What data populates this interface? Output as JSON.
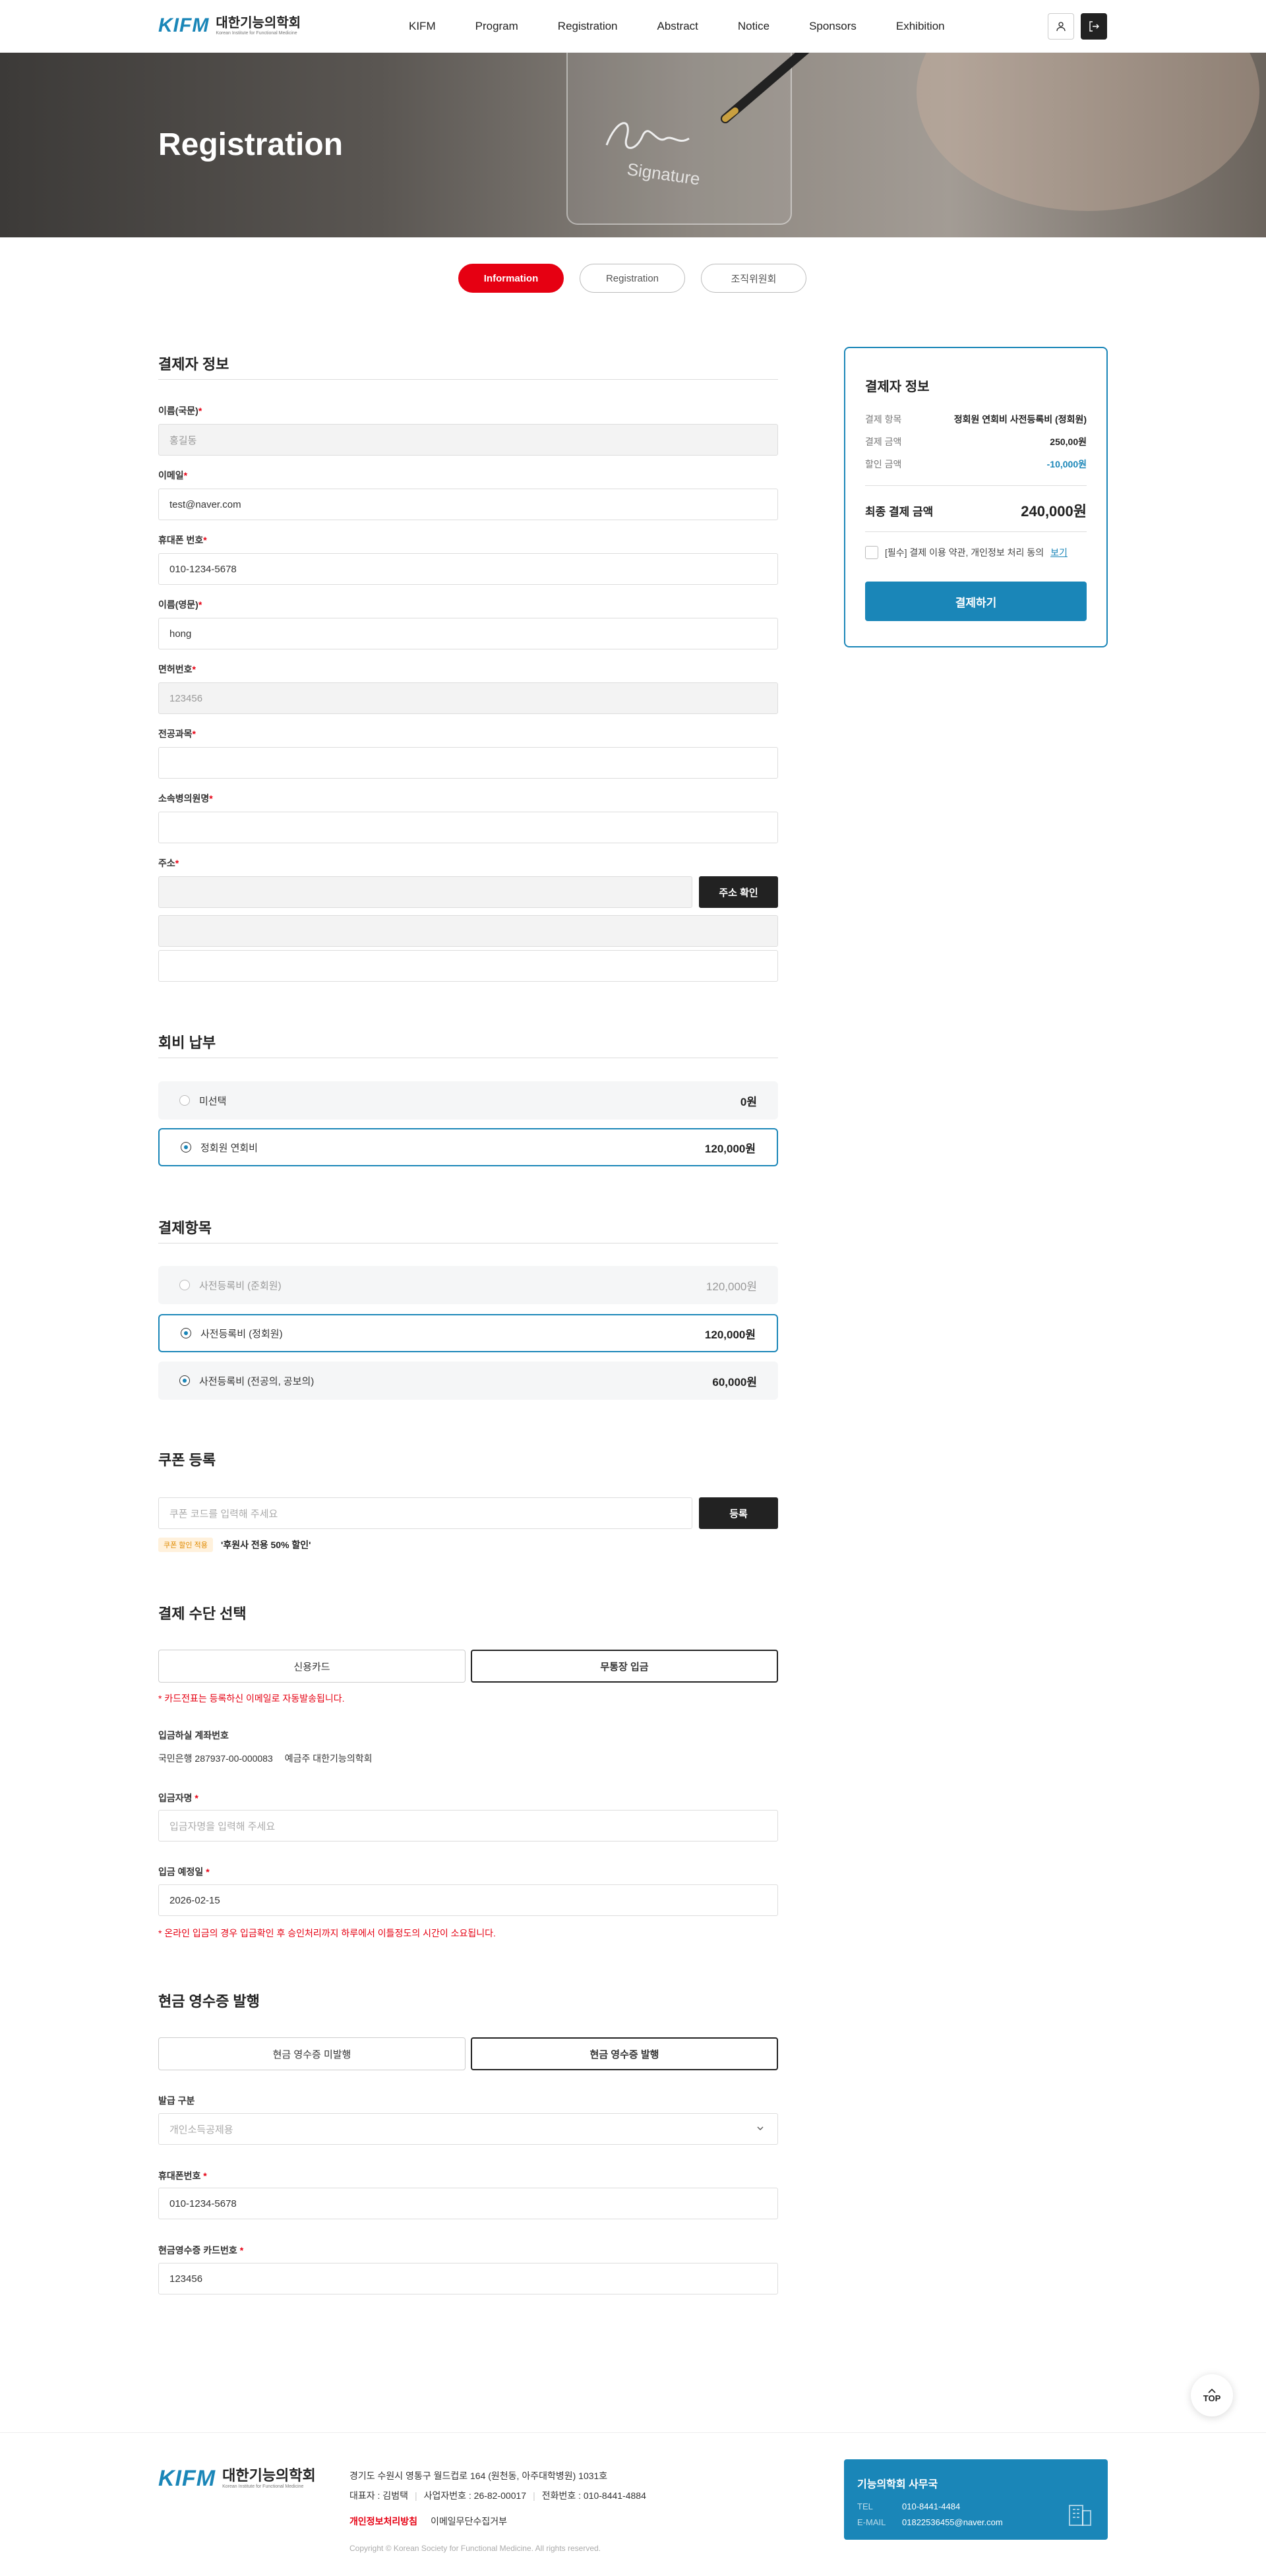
{
  "header": {
    "logo_mark": "KIFM",
    "logo_ko": "대한기능의학회",
    "logo_en": "Korean Institute for Functional Medicine",
    "nav": [
      "KIFM",
      "Program",
      "Registration",
      "Abstract",
      "Notice",
      "Sponsors",
      "Exhibition"
    ],
    "icons": {
      "user": "user-icon",
      "logout": "logout-icon"
    }
  },
  "hero": {
    "title": "Registration",
    "signature_text": "Signature"
  },
  "tabs": [
    "Information",
    "Registration",
    "조직위원회"
  ],
  "payer": {
    "title": "결제자 정보",
    "name_ko": {
      "label": "이름(국문)",
      "placeholder": "홍길동"
    },
    "email": {
      "label": "이메일",
      "value": "test@naver.com"
    },
    "phone": {
      "label": "휴대폰 번호",
      "value": "010-1234-5678"
    },
    "name_en": {
      "label": "이름(영문)",
      "value": "hong"
    },
    "license": {
      "label": "면허번호",
      "placeholder": "123456"
    },
    "major": {
      "label": "전공과목"
    },
    "hospital": {
      "label": "소속병의원명"
    },
    "address": {
      "label": "주소",
      "button": "주소 확인"
    }
  },
  "membership": {
    "title": "회비 납부",
    "options": [
      {
        "label": "미선택",
        "price": "0원"
      },
      {
        "label": "정회원 연회비",
        "price": "120,000원"
      }
    ]
  },
  "items": {
    "title": "결제항목",
    "options": [
      {
        "label": "사전등록비 (준회원)",
        "price": "120,000원"
      },
      {
        "label": "사전등록비 (정회원)",
        "price": "120,000원"
      },
      {
        "label": "사전등록비 (전공의, 공보의)",
        "price": "60,000원"
      }
    ]
  },
  "coupon": {
    "title": "쿠폰 등록",
    "placeholder": "쿠폰 코드를 입력해 주세요",
    "button": "등록",
    "badge": "쿠폰 할인 적용",
    "applied": "'후원사 전용 50% 할인'"
  },
  "payment_method": {
    "title": "결제 수단 선택",
    "options": [
      "신용카드",
      "무통장 입금"
    ],
    "card_notice": "* 카드전표는 등록하신 이메일로 자동발송됩니다.",
    "account_label": "입금하실 계좌번호",
    "account_bank": "국민은행",
    "account_number": "287937-00-000083",
    "account_holder_label": "예금주",
    "account_holder": "대한기능의학회",
    "depositor": {
      "label": "입금자명",
      "placeholder": "입금자명을 입력해 주세요"
    },
    "deposit_date": {
      "label": "입금 예정일",
      "value": "2026-02-15"
    },
    "deposit_notice": "* 온라인 입금의 경우 입금확인 후 승인처리까지 하루에서 이틀정도의 시간이 소요됩니다."
  },
  "receipt": {
    "title": "현금 영수증 발행",
    "options": [
      "현금 영수증 미발행",
      "현금 영수증 발행"
    ],
    "type": {
      "label": "발급 구분",
      "value": "개인소득공제용"
    },
    "phone": {
      "label": "휴대폰번호",
      "value": "010-1234-5678"
    },
    "card": {
      "label": "현금영수증 카드번호",
      "value": "123456"
    }
  },
  "summary": {
    "title": "결제자 정보",
    "rows": [
      {
        "k": "결제 항목",
        "v": "정회원 연회비 사전등록비 (정회원)"
      },
      {
        "k": "결제 금액",
        "v": "250,00원"
      },
      {
        "k": "할인 금액",
        "v": "-10,000원"
      }
    ],
    "total_label": "최종 결제 금액",
    "total_value": "240,000원",
    "agree_text": "[필수] 결제 이용 약관, 개인정보 처리 동의",
    "agree_link": "보기",
    "pay_button": "결제하기"
  },
  "top_button": "TOP",
  "footer": {
    "logo_mark": "KIFM",
    "logo_ko": "대한기능의학회",
    "logo_en": "Korean Institute for Functional Medicine",
    "address": "경기도 수원시 영통구 월드컵로 164 (원천동, 아주대학병원) 1031호",
    "ceo": "대표자 : 김범택",
    "biz_no": "사업자번호 : 26-82-00017",
    "tel": "전화번호 : 010-8441-4884",
    "privacy": "개인정보처리방침",
    "email_policy": "이메일무단수집거부",
    "copyright": "Copyright © Korean Society for Functional Medicine. All rights reserved.",
    "office_title": "기능의학회 사무국",
    "office_tel_label": "TEL",
    "office_tel": "010-8441-4484",
    "office_email_label": "E-MAIL",
    "office_email": "01822536455@naver.com"
  },
  "colors": {
    "accent": "#1a86b8",
    "primary_red": "#e60012",
    "dark": "#222222"
  }
}
